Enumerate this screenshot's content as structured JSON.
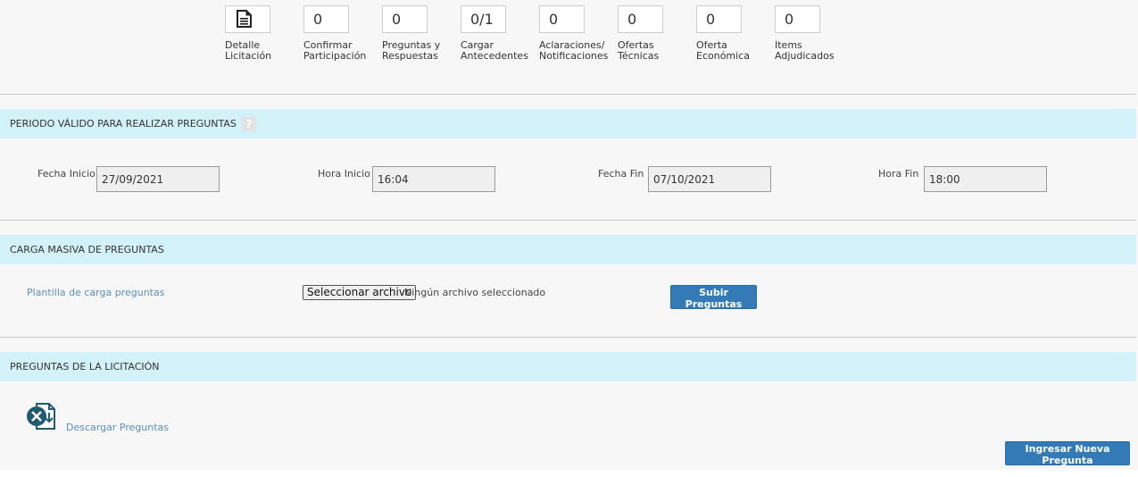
{
  "steps": [
    {
      "value": "",
      "label": "Detalle\nLicitación",
      "icon": "document-icon"
    },
    {
      "value": "0",
      "label": "Confirmar\nParticipación"
    },
    {
      "value": "0",
      "label": "Preguntas y\nRespuestas"
    },
    {
      "value": "0/1",
      "label": "Cargar\nAntecedentes"
    },
    {
      "value": "0",
      "label": "Aclaraciones/\nNotificaciones"
    },
    {
      "value": "0",
      "label": "Ofertas\nTécnicas"
    },
    {
      "value": "0",
      "label": "Oferta\nEconómica"
    },
    {
      "value": "0",
      "label": "Items\nAdjudicados"
    }
  ],
  "period": {
    "title": "PERIODO VÁLIDO PARA REALIZAR PREGUNTAS",
    "help": "?",
    "fecha_inicio_label": "Fecha Inicio",
    "fecha_inicio": "27/09/2021",
    "hora_inicio_label": "Hora Inicio",
    "hora_inicio": "16:04",
    "fecha_fin_label": "Fecha Fin",
    "fecha_fin": "07/10/2021",
    "hora_fin_label": "Hora Fin",
    "hora_fin": "18:00"
  },
  "bulk": {
    "title": "CARGA MASIVA DE PREGUNTAS",
    "template_link": "Plantilla de carga preguntas",
    "file_button": "Seleccionar archivo",
    "file_status": "Ningún archivo seleccionado",
    "upload_button": "Subir Preguntas"
  },
  "questions": {
    "title": "PREGUNTAS DE LA LICITACIÓN",
    "download_link": "Descargar Preguntas",
    "new_button": "Ingresar Nueva Pregunta"
  },
  "colors": {
    "header_bg": "#d3f1f8",
    "primary": "#337ab7",
    "link": "#5a8fbf"
  }
}
